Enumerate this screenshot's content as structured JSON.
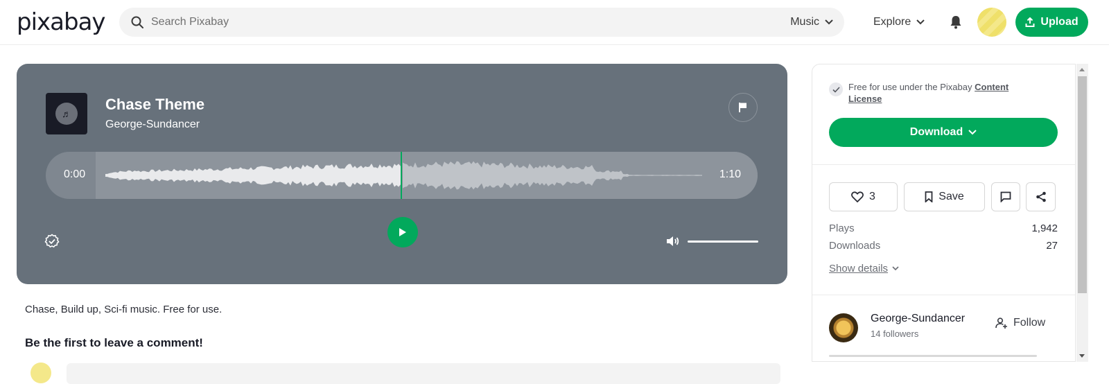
{
  "brand": {
    "logo_text": "pixabay",
    "accent": "#02a95c"
  },
  "header": {
    "search_placeholder": "Search Pixabay",
    "search_type": "Music",
    "explore_label": "Explore",
    "upload_label": "Upload"
  },
  "player": {
    "title": "Chase Theme",
    "artist": "George-Sundancer",
    "time_current": "0:00",
    "time_total": "1:10",
    "volume_level": 1.0,
    "bg_color": "#67717b"
  },
  "description": "Chase, Build up, Sci-fi music. Free for use.",
  "comments": {
    "heading": "Be the first to leave a comment!"
  },
  "sidebar": {
    "license_text": "Free for use under the Pixabay ",
    "license_link": "Content License",
    "download_label": "Download",
    "likes_count": "3",
    "save_label": "Save",
    "stats": [
      {
        "label": "Plays",
        "value": "1,942"
      },
      {
        "label": "Downloads",
        "value": "27"
      }
    ],
    "show_details_label": "Show details",
    "author": {
      "name": "George-Sundancer",
      "followers": "14 followers",
      "follow_label": "Follow"
    }
  }
}
